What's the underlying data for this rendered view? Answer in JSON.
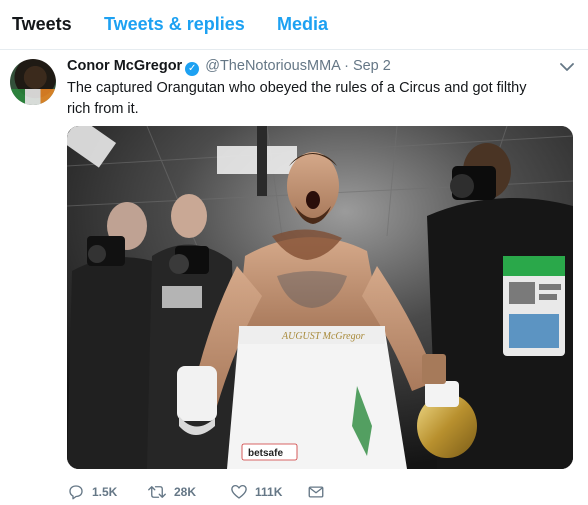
{
  "tabs": [
    {
      "label": "Tweets",
      "active": true
    },
    {
      "label": "Tweets & replies",
      "active": false
    },
    {
      "label": "Media",
      "active": false
    }
  ],
  "tweet": {
    "name": "Conor McGregor",
    "verified": true,
    "handle": "@TheNotoriousMMA",
    "separator": "·",
    "date": "Sep 2",
    "text": "The captured Orangutan who obeyed the rules of a Circus and got filthy rich from it.",
    "media": {
      "shorts_waistband_text": "AUGUST McGregor",
      "shorts_sponsor_text": "betsafe",
      "glove_brand_text": "",
      "accent_colors": [
        "#d4b04a",
        "#f2f2f2",
        "#1da1f2"
      ]
    },
    "stats": {
      "replies": "1.5K",
      "retweets": "28K",
      "likes": "111K"
    },
    "icons": {
      "verified": "verified-badge-icon",
      "caret": "chevron-down-icon",
      "reply": "reply-icon",
      "retweet": "retweet-icon",
      "like": "heart-icon",
      "dm": "envelope-icon"
    }
  },
  "colors": {
    "accent": "#1da1f2",
    "text": "#14171a",
    "muted": "#657786",
    "border": "#e6ecf0"
  }
}
